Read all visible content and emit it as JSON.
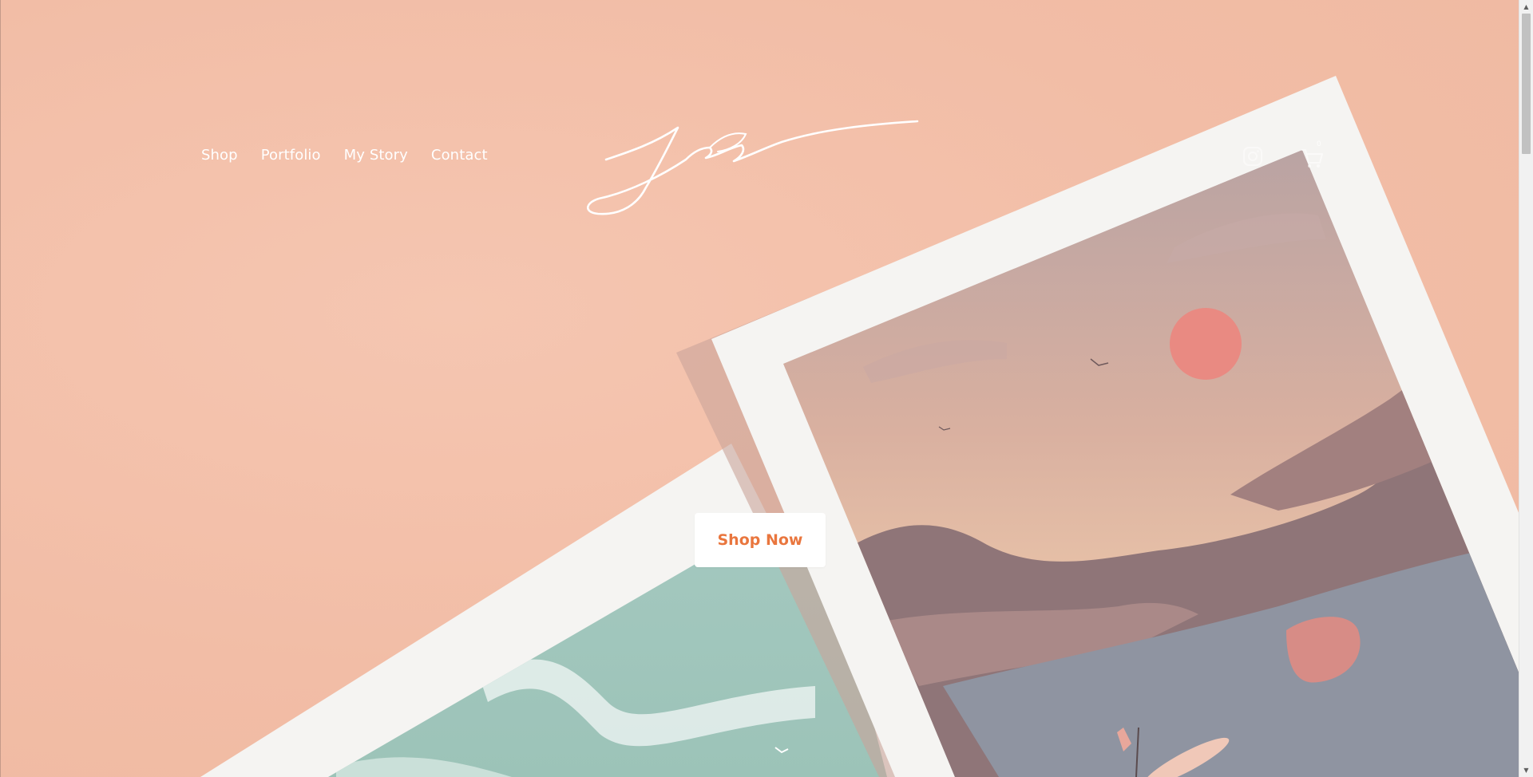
{
  "nav": {
    "items": [
      {
        "label": "Shop"
      },
      {
        "label": "Portfolio"
      },
      {
        "label": "My Story"
      },
      {
        "label": "Contact"
      }
    ]
  },
  "header": {
    "logo_icon": "signature-logo",
    "social_icon": "instagram-icon",
    "cart_icon": "cart-icon",
    "cart_count": "0"
  },
  "hero": {
    "cta_label": "Shop Now",
    "artworks": [
      {
        "name": "beach-waves-print"
      },
      {
        "name": "sunset-lake-print"
      }
    ]
  },
  "colors": {
    "background": "#f3bfa9",
    "accent": "#e9763e",
    "frame": "#f5f4f2"
  }
}
